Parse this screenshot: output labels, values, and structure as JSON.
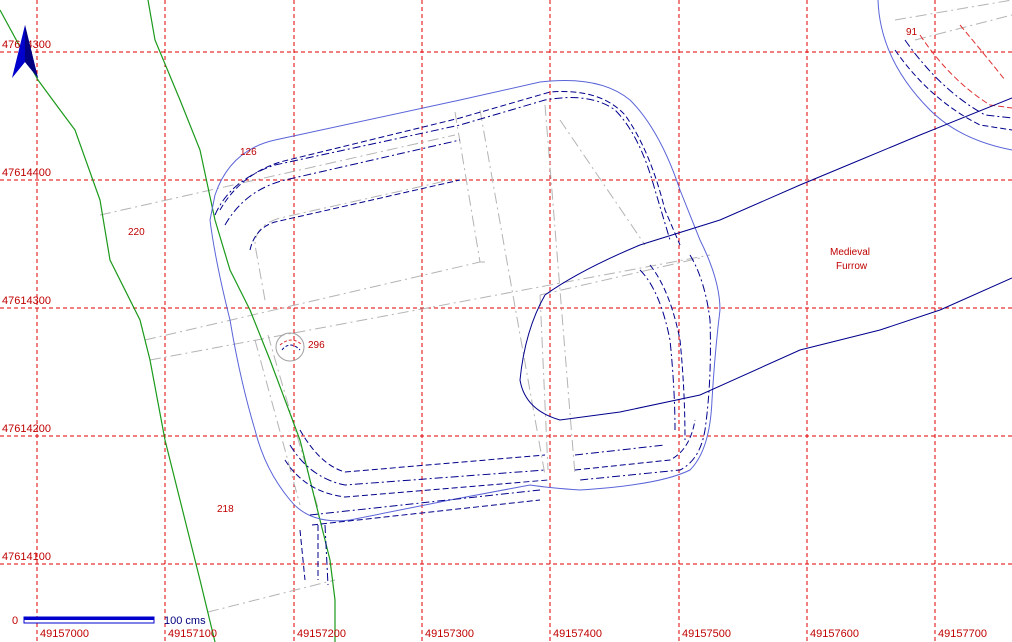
{
  "grid": {
    "x_labels": [
      "49157000",
      "49157100",
      "49157200",
      "49157300",
      "49157400",
      "49157500",
      "49157600",
      "49157700"
    ],
    "y_labels": [
      "47614300",
      "47614400",
      "47614300",
      "47614200",
      "47614100"
    ]
  },
  "features": {
    "f126": "126",
    "f220": "220",
    "f296": "296",
    "f218": "218",
    "f91": "91",
    "furrow_line1": "Medieval",
    "furrow_line2": "Furrow"
  },
  "scale_bar": {
    "start": "0",
    "end": "100 cms"
  },
  "north_arrow": "north-arrow",
  "colors": {
    "grid": "#e00000",
    "labels": "#c00000",
    "trench": "#00008c",
    "boundary": "#1a9a1a",
    "outline": "#5a64d8",
    "baulk": "#b4b4b4"
  }
}
